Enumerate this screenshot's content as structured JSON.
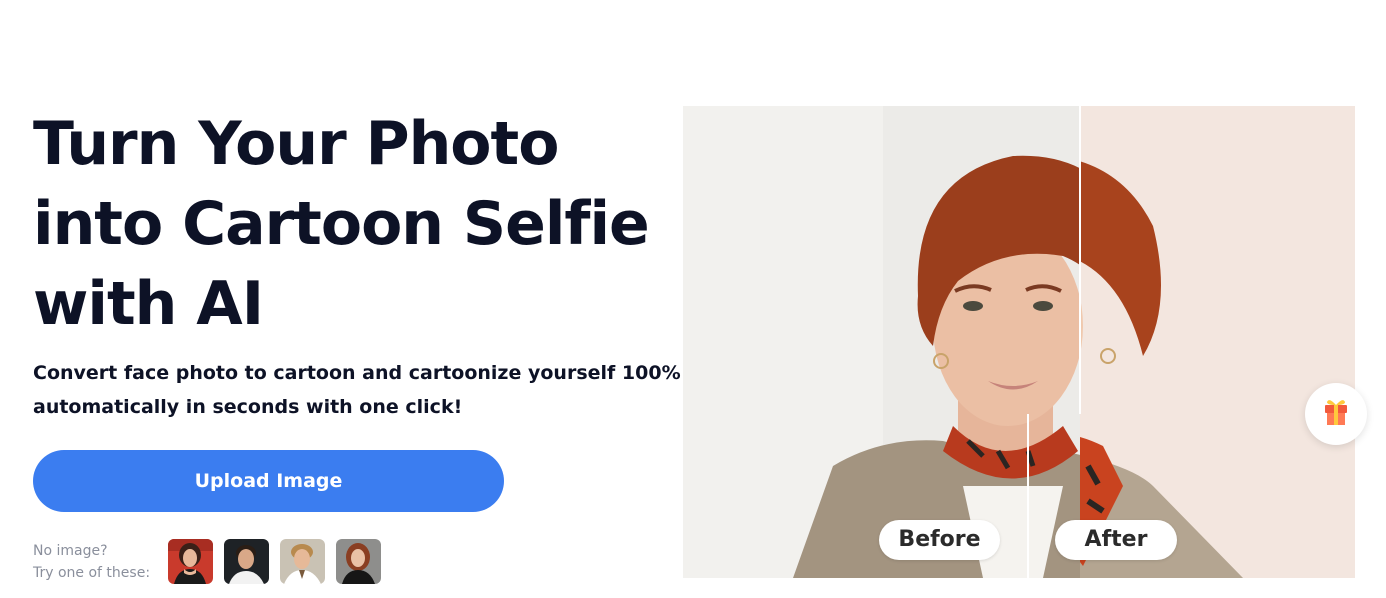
{
  "hero": {
    "title_lines": [
      "Turn Your Photo",
      "into Cartoon Selfie",
      "with AI"
    ],
    "subtitle_lines": [
      "Convert face photo to cartoon and cartoonize yourself 100%",
      "automatically in seconds with one click!"
    ],
    "upload_label": "Upload Image"
  },
  "samples": {
    "label_lines": [
      "No image?",
      "Try one of these:"
    ],
    "thumbnails": [
      {
        "icon": "woman-portrait-red-background"
      },
      {
        "icon": "man-portrait-dark-background"
      },
      {
        "icon": "man-portrait-light-background"
      },
      {
        "icon": "woman-portrait-gray-background"
      }
    ]
  },
  "comparison": {
    "before_label": "Before",
    "after_label": "After",
    "divider_position": 0.59
  },
  "floating": {
    "gift_icon": "gift-icon"
  },
  "colors": {
    "primary": "#3b7df0",
    "heading": "#0d1226",
    "muted": "#8a8f9c"
  }
}
